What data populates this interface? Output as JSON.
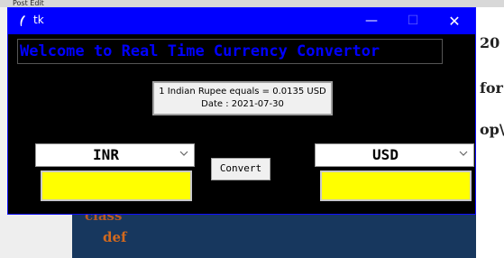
{
  "background": {
    "tabs": [
      "Post Edit",
      "",
      ""
    ],
    "right_text": [
      "20",
      "for",
      "op\\"
    ],
    "code_class": "class",
    "code_def": "def"
  },
  "window": {
    "title": "tk",
    "minimize": "—",
    "maximize": "☐",
    "close": "✕"
  },
  "app": {
    "heading": "Welcome to Real Time Currency Convertor",
    "rate_line1": "1 Indian Rupee equals = 0.0135 USD",
    "rate_line2": "Date : 2021-07-30",
    "from_currency": "INR",
    "to_currency": "USD",
    "from_amount": "",
    "to_amount": "",
    "convert_label": "Convert"
  },
  "colors": {
    "titlebar": "#0000ff",
    "heading_text": "#0000ff",
    "amount_fill": "#ffff00",
    "window_bg": "#000000"
  }
}
